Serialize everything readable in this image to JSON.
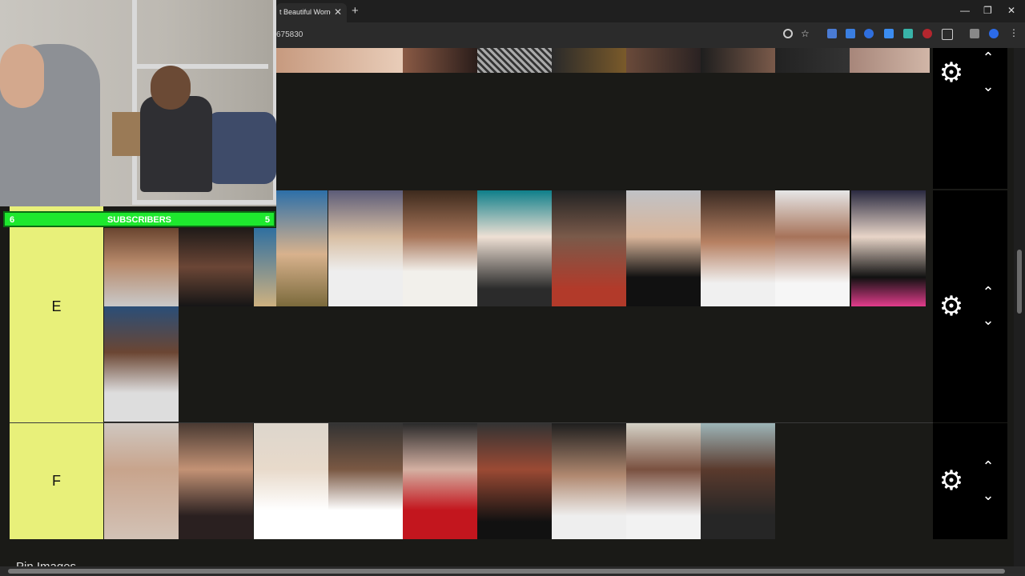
{
  "browser": {
    "tab_title": "t Beautiful Wome",
    "close": "✕",
    "new_tab": "+",
    "url": "675830",
    "min": "—",
    "restore": "❐",
    "exit": "✕"
  },
  "overlay": {
    "left": "6",
    "label": "SUBSCRIBERS",
    "right": "5"
  },
  "tiers": [
    {
      "label": "E",
      "count": 11
    },
    {
      "label": "F",
      "count": 9
    }
  ],
  "controls": {
    "gear": "⚙",
    "up": "⌃",
    "down": "⌄"
  },
  "footer": {
    "pin_label": "Pin Images"
  },
  "colors": {
    "tier_label_bg": "#e8f07a",
    "accent_green": "#1ee82e"
  }
}
